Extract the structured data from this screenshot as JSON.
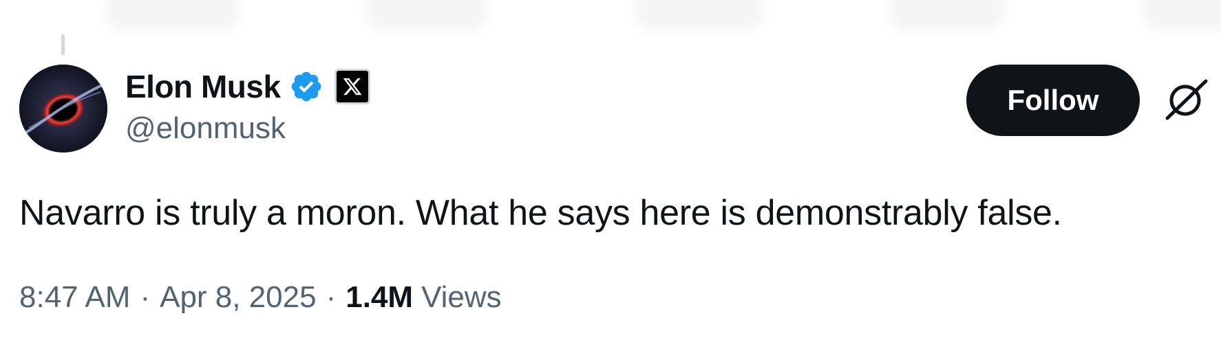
{
  "author": {
    "display_name": "Elon Musk",
    "handle": "@elonmusk",
    "verified_icon": "verified-badge-icon",
    "affiliation_icon": "x-logo-icon"
  },
  "actions": {
    "follow_label": "Follow",
    "grok_icon": "grok-icon"
  },
  "tweet": {
    "text": "Navarro is truly a moron. What he says here is demonstrably false."
  },
  "meta": {
    "time": "8:47 AM",
    "separator": "·",
    "date": "Apr 8, 2025",
    "views_count": "1.4M",
    "views_label": "Views"
  },
  "colors": {
    "text_primary": "#0f1419",
    "text_secondary": "#536471",
    "verified_blue": "#1d9bf0",
    "button_bg": "#0f1419"
  }
}
